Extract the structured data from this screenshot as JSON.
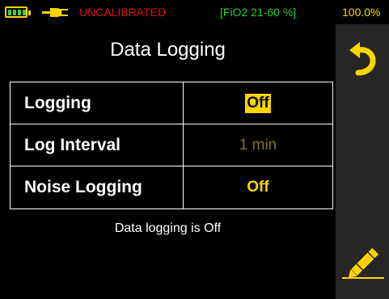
{
  "status_bar": {
    "battery_icon": "battery-full-icon",
    "power_icon": "plug-icon",
    "calibration_text": "UNCALIBRATED",
    "fio2_range": "[FiO2 21-60 %]",
    "percent": "100.0%",
    "colors": {
      "calibration": "#e01010",
      "fio2": "#2ecc2e",
      "percent": "#ffd400",
      "battery": "#ffd400",
      "battery_fill": "#3fd23f"
    }
  },
  "title": "Data Logging",
  "settings": [
    {
      "label": "Logging",
      "value": "Off",
      "state": "selected"
    },
    {
      "label": "Log Interval",
      "value": "1 min",
      "state": "disabled"
    },
    {
      "label": "Noise Logging",
      "value": "Off",
      "state": "normal"
    }
  ],
  "status_message": "Data logging is Off",
  "right_panel": {
    "back_icon": "back-arrow-icon",
    "edit_icon": "pencil-edit-icon"
  },
  "colors": {
    "accent": "#ffd400",
    "background": "#000000",
    "panel": "#262626"
  }
}
